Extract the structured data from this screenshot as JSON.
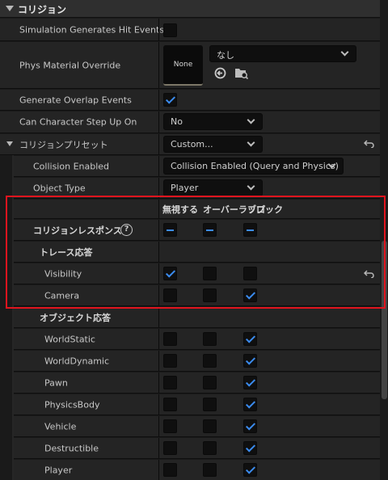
{
  "header": {
    "title": "コリジョン"
  },
  "simulation_hit": {
    "label": "Simulation Generates Hit Events",
    "checked": false
  },
  "phys_material": {
    "label": "Phys Material Override",
    "thumb": "None",
    "value": "なし"
  },
  "overlap": {
    "label": "Generate Overlap Events",
    "checked": true
  },
  "step_up": {
    "label": "Can Character Step Up On",
    "value": "No"
  },
  "preset": {
    "label": "コリジョンプリセット",
    "value": "Custom..."
  },
  "collision_enabled": {
    "label": "Collision Enabled",
    "value": "Collision Enabled (Query and Physics)"
  },
  "object_type": {
    "label": "Object Type",
    "value": "Player"
  },
  "columns": {
    "ignore": "無視する",
    "overlap": "オーバーラップ",
    "block": "ブロック"
  },
  "responses_label": "コリジョンレスポンス",
  "trace_label": "トレース応答",
  "object_label": "オブジェクト応答",
  "trace_rows": [
    {
      "name": "Visibility",
      "state": "ignore"
    },
    {
      "name": "Camera",
      "state": "block"
    }
  ],
  "object_rows": [
    {
      "name": "WorldStatic",
      "state": "block"
    },
    {
      "name": "WorldDynamic",
      "state": "block"
    },
    {
      "name": "Pawn",
      "state": "block"
    },
    {
      "name": "PhysicsBody",
      "state": "block"
    },
    {
      "name": "Vehicle",
      "state": "block"
    },
    {
      "name": "Destructible",
      "state": "block"
    },
    {
      "name": "Player",
      "state": "block"
    }
  ],
  "accent_color": "#3b8cf0",
  "highlight_color": "#e0141e",
  "icons": [
    "collapse-triangle-icon",
    "chevron-down-icon",
    "checkbox-check-icon",
    "reset-arrow-icon",
    "help-icon",
    "use-selected-arrow-icon",
    "browse-folder-icon"
  ]
}
